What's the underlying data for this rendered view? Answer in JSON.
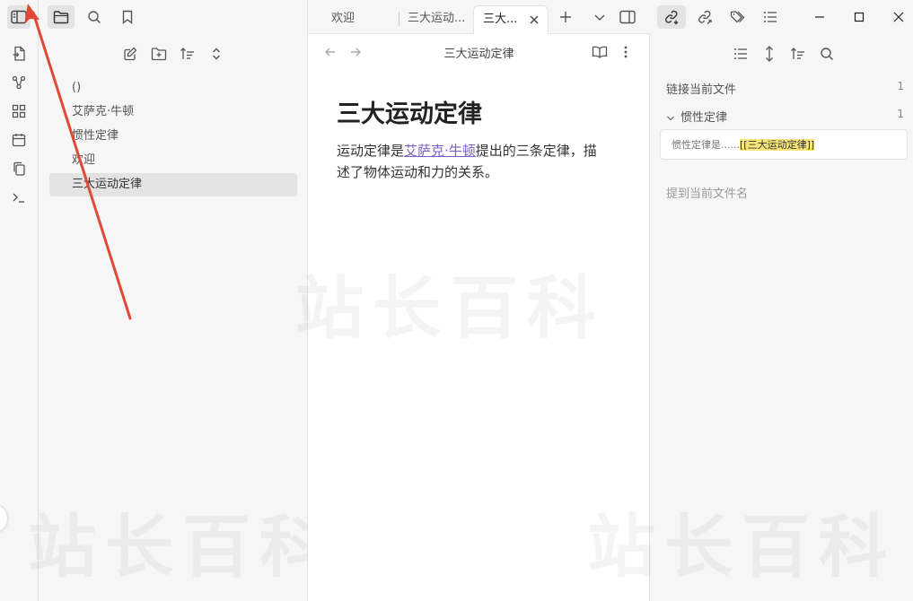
{
  "left_sidebar": {
    "files": [
      "()",
      "艾萨克·牛顿",
      "惯性定律",
      "欢迎",
      "三大运动定律"
    ]
  },
  "tabs": [
    {
      "label": "欢迎"
    },
    {
      "label": "三大运动..."
    },
    {
      "label": "三大..."
    }
  ],
  "view_header": {
    "title": "三大运动定律"
  },
  "document": {
    "heading": "三大运动定律",
    "text_before": "运动定律是",
    "link_text": "艾萨克·牛顿",
    "text_after": "提出的三条定律，描述了物体运动和力的关系。"
  },
  "backlinks": {
    "linked_title": "链接当前文件",
    "linked_count": "1",
    "group_title": "惯性定律",
    "group_count": "1",
    "snippet_prefix": "惯性定律是......",
    "snippet_link": "[[三大运动定律]]",
    "unlinked_title": "提到当前文件名"
  },
  "watermark": {
    "text": "站长百科"
  },
  "colors": {
    "annotation_arrow": "#e04a35",
    "link": "#7a5cc4",
    "highlight": "#f8e57a"
  }
}
